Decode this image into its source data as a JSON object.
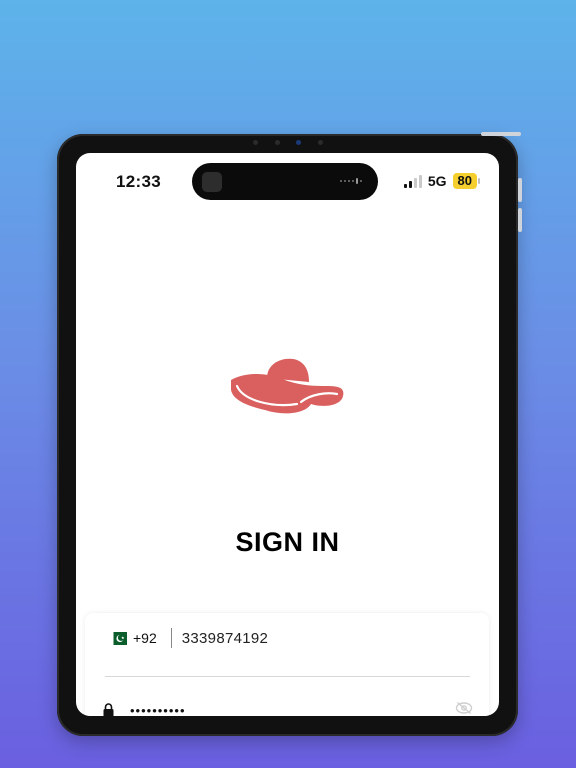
{
  "status_bar": {
    "time": "12:33",
    "network": "5G",
    "battery": "80",
    "battery_color": "#f4cf2e"
  },
  "app": {
    "logo_icon": "sun-hat-logo",
    "logo_color": "#d9605e",
    "title": "SIGN IN"
  },
  "form": {
    "phone": {
      "country_flag_icon": "pakistan-flag-icon",
      "country_code": "+92",
      "value": "3339874192"
    },
    "password": {
      "icon": "lock-icon",
      "value": "••••••••••",
      "toggle_icon": "eye-off-icon"
    }
  },
  "colors": {
    "background_top": "#5db3ea",
    "background_bottom": "#6a5fe0",
    "device_frame": "#111111"
  }
}
